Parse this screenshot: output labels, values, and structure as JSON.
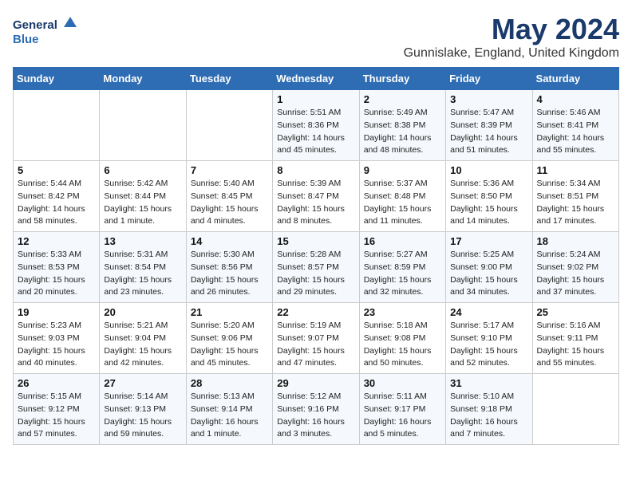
{
  "logo": {
    "line1": "General",
    "line2": "Blue"
  },
  "title": "May 2024",
  "subtitle": "Gunnislake, England, United Kingdom",
  "days_header": [
    "Sunday",
    "Monday",
    "Tuesday",
    "Wednesday",
    "Thursday",
    "Friday",
    "Saturday"
  ],
  "weeks": [
    [
      {
        "day": "",
        "info": ""
      },
      {
        "day": "",
        "info": ""
      },
      {
        "day": "",
        "info": ""
      },
      {
        "day": "1",
        "info": "Sunrise: 5:51 AM\nSunset: 8:36 PM\nDaylight: 14 hours\nand 45 minutes."
      },
      {
        "day": "2",
        "info": "Sunrise: 5:49 AM\nSunset: 8:38 PM\nDaylight: 14 hours\nand 48 minutes."
      },
      {
        "day": "3",
        "info": "Sunrise: 5:47 AM\nSunset: 8:39 PM\nDaylight: 14 hours\nand 51 minutes."
      },
      {
        "day": "4",
        "info": "Sunrise: 5:46 AM\nSunset: 8:41 PM\nDaylight: 14 hours\nand 55 minutes."
      }
    ],
    [
      {
        "day": "5",
        "info": "Sunrise: 5:44 AM\nSunset: 8:42 PM\nDaylight: 14 hours\nand 58 minutes."
      },
      {
        "day": "6",
        "info": "Sunrise: 5:42 AM\nSunset: 8:44 PM\nDaylight: 15 hours\nand 1 minute."
      },
      {
        "day": "7",
        "info": "Sunrise: 5:40 AM\nSunset: 8:45 PM\nDaylight: 15 hours\nand 4 minutes."
      },
      {
        "day": "8",
        "info": "Sunrise: 5:39 AM\nSunset: 8:47 PM\nDaylight: 15 hours\nand 8 minutes."
      },
      {
        "day": "9",
        "info": "Sunrise: 5:37 AM\nSunset: 8:48 PM\nDaylight: 15 hours\nand 11 minutes."
      },
      {
        "day": "10",
        "info": "Sunrise: 5:36 AM\nSunset: 8:50 PM\nDaylight: 15 hours\nand 14 minutes."
      },
      {
        "day": "11",
        "info": "Sunrise: 5:34 AM\nSunset: 8:51 PM\nDaylight: 15 hours\nand 17 minutes."
      }
    ],
    [
      {
        "day": "12",
        "info": "Sunrise: 5:33 AM\nSunset: 8:53 PM\nDaylight: 15 hours\nand 20 minutes."
      },
      {
        "day": "13",
        "info": "Sunrise: 5:31 AM\nSunset: 8:54 PM\nDaylight: 15 hours\nand 23 minutes."
      },
      {
        "day": "14",
        "info": "Sunrise: 5:30 AM\nSunset: 8:56 PM\nDaylight: 15 hours\nand 26 minutes."
      },
      {
        "day": "15",
        "info": "Sunrise: 5:28 AM\nSunset: 8:57 PM\nDaylight: 15 hours\nand 29 minutes."
      },
      {
        "day": "16",
        "info": "Sunrise: 5:27 AM\nSunset: 8:59 PM\nDaylight: 15 hours\nand 32 minutes."
      },
      {
        "day": "17",
        "info": "Sunrise: 5:25 AM\nSunset: 9:00 PM\nDaylight: 15 hours\nand 34 minutes."
      },
      {
        "day": "18",
        "info": "Sunrise: 5:24 AM\nSunset: 9:02 PM\nDaylight: 15 hours\nand 37 minutes."
      }
    ],
    [
      {
        "day": "19",
        "info": "Sunrise: 5:23 AM\nSunset: 9:03 PM\nDaylight: 15 hours\nand 40 minutes."
      },
      {
        "day": "20",
        "info": "Sunrise: 5:21 AM\nSunset: 9:04 PM\nDaylight: 15 hours\nand 42 minutes."
      },
      {
        "day": "21",
        "info": "Sunrise: 5:20 AM\nSunset: 9:06 PM\nDaylight: 15 hours\nand 45 minutes."
      },
      {
        "day": "22",
        "info": "Sunrise: 5:19 AM\nSunset: 9:07 PM\nDaylight: 15 hours\nand 47 minutes."
      },
      {
        "day": "23",
        "info": "Sunrise: 5:18 AM\nSunset: 9:08 PM\nDaylight: 15 hours\nand 50 minutes."
      },
      {
        "day": "24",
        "info": "Sunrise: 5:17 AM\nSunset: 9:10 PM\nDaylight: 15 hours\nand 52 minutes."
      },
      {
        "day": "25",
        "info": "Sunrise: 5:16 AM\nSunset: 9:11 PM\nDaylight: 15 hours\nand 55 minutes."
      }
    ],
    [
      {
        "day": "26",
        "info": "Sunrise: 5:15 AM\nSunset: 9:12 PM\nDaylight: 15 hours\nand 57 minutes."
      },
      {
        "day": "27",
        "info": "Sunrise: 5:14 AM\nSunset: 9:13 PM\nDaylight: 15 hours\nand 59 minutes."
      },
      {
        "day": "28",
        "info": "Sunrise: 5:13 AM\nSunset: 9:14 PM\nDaylight: 16 hours\nand 1 minute."
      },
      {
        "day": "29",
        "info": "Sunrise: 5:12 AM\nSunset: 9:16 PM\nDaylight: 16 hours\nand 3 minutes."
      },
      {
        "day": "30",
        "info": "Sunrise: 5:11 AM\nSunset: 9:17 PM\nDaylight: 16 hours\nand 5 minutes."
      },
      {
        "day": "31",
        "info": "Sunrise: 5:10 AM\nSunset: 9:18 PM\nDaylight: 16 hours\nand 7 minutes."
      },
      {
        "day": "",
        "info": ""
      }
    ]
  ]
}
